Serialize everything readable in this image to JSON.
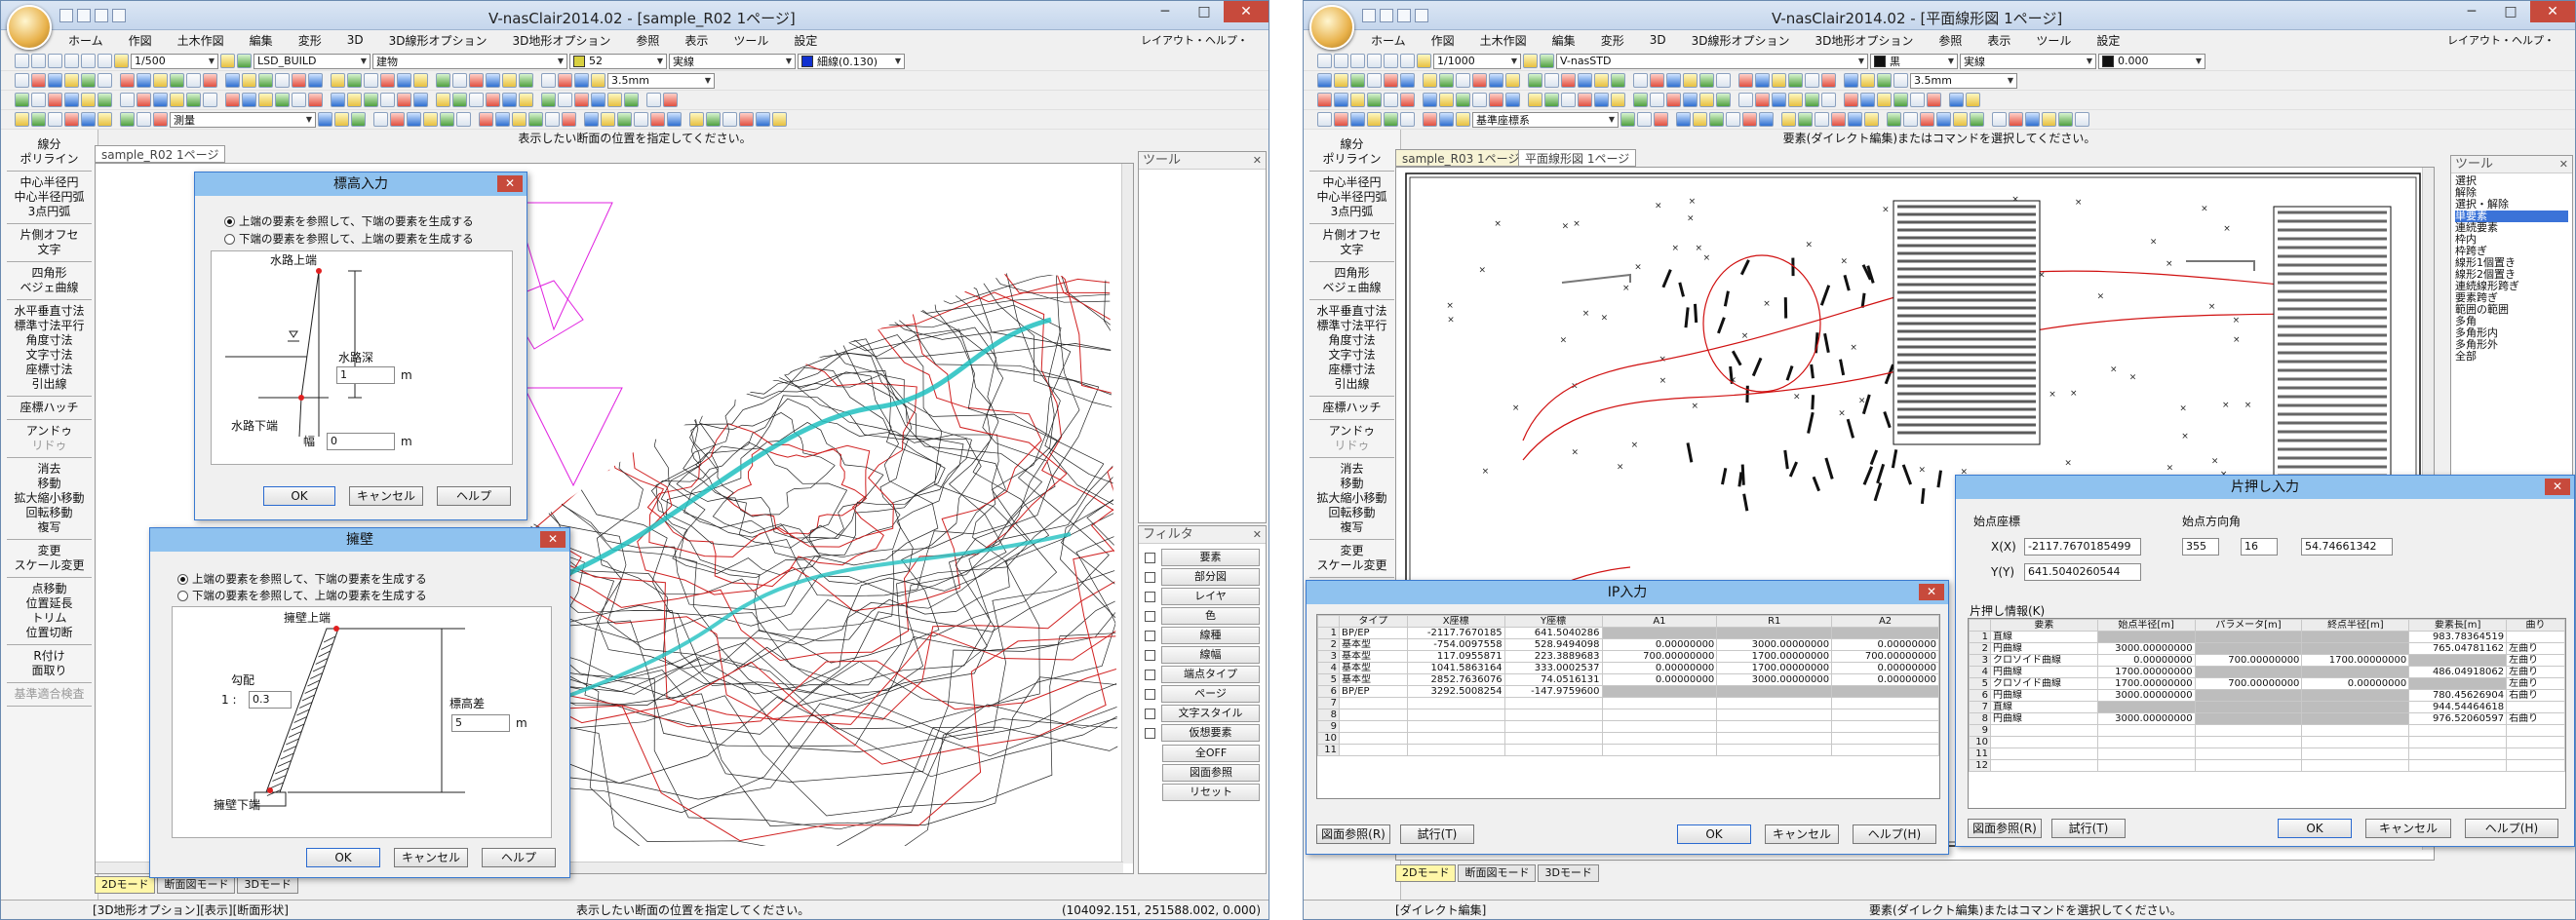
{
  "left": {
    "title": "V-nasClair2014.02 - [sample_R02 1ページ]",
    "menu": [
      "ホーム",
      "作図",
      "土木作図",
      "編集",
      "変形",
      "3D",
      "3D線形オプション",
      "3D地形オプション",
      "参照",
      "表示",
      "ツール",
      "設定"
    ],
    "menu_right": "レイアウト・ヘルプ・",
    "toolbar": {
      "scale": "1/500",
      "layer": "LSD_BUILD",
      "category": "建物",
      "color_num": "52",
      "line_type": "実線",
      "line_weight": "細線(0.130)",
      "width": "3.5mm",
      "mode": "測量"
    },
    "prompt": "表示したい断面の位置を指定してください。",
    "doc_tab": "sample_R02 1ページ",
    "commands": [
      [
        "線分",
        "ポリライン"
      ],
      [
        "中心半径円",
        "中心半径円弧",
        "3点円弧"
      ],
      [
        "片側オフセ",
        "文字"
      ],
      [
        "四角形",
        "ベジェ曲線"
      ],
      [
        "水平垂直寸法",
        "標準寸法平行",
        "角度寸法",
        "文字寸法",
        "座標寸法",
        "引出線"
      ],
      [
        "座標ハッチ"
      ],
      [
        "アンドゥ",
        "リドゥ"
      ],
      [
        "消去",
        "移動",
        "拡大縮小移動",
        "回転移動",
        "複写"
      ],
      [
        "変更",
        "スケール変更"
      ],
      [
        "点移動",
        "位置延長",
        "トリム",
        "位置切断"
      ],
      [
        "R付け",
        "面取り"
      ],
      [
        "基準適合検査"
      ]
    ],
    "tool_panel_title": "ツール",
    "filter_title": "フィルタ",
    "filters": [
      "要素",
      "部分図",
      "レイヤ",
      "色",
      "線種",
      "線幅",
      "端点タイプ",
      "ページ",
      "文字スタイル",
      "仮想要素"
    ],
    "filter_buttons": [
      "全OFF",
      "図面参照",
      "リセット"
    ],
    "mode_tabs": [
      "2Dモード",
      "断面図モード",
      "3Dモード"
    ],
    "status_left": "[3D地形オプション][表示][断面形状]",
    "status_center": "表示したい断面の位置を指定してください。",
    "status_right": "(104092.151, 251588.002, 0.000)",
    "dialog_elev": {
      "title": "標高入力",
      "opt1": "上端の要素を参照して、下端の要素を生成する",
      "opt2": "下端の要素を参照して、上端の要素を生成する",
      "top_label": "水路上端",
      "bottom_label": "水路下端",
      "depth_label": "水路深",
      "depth_value": "1",
      "depth_unit": "m",
      "width_label": "幅",
      "width_value": "0",
      "width_unit": "m",
      "ok": "OK",
      "cancel": "キャンセル",
      "help": "ヘルプ"
    },
    "dialog_wall": {
      "title": "擁壁",
      "opt1": "上端の要素を参照して、下端の要素を生成する",
      "opt2": "下端の要素を参照して、上端の要素を生成する",
      "top_label": "擁壁上端",
      "bottom_label": "擁壁下端",
      "slope_label": "勾配",
      "slope_prefix": "1 :",
      "slope_value": "0.3",
      "height_label": "標高差",
      "height_value": "5",
      "height_unit": "m",
      "ok": "OK",
      "cancel": "キャンセル",
      "help": "ヘルプ"
    }
  },
  "right": {
    "title": "V-nasClair2014.02 - [平面線形図 1ページ]",
    "menu": [
      "ホーム",
      "作図",
      "土木作図",
      "編集",
      "変形",
      "3D",
      "3D線形オプション",
      "3D地形オプション",
      "参照",
      "表示",
      "ツール",
      "設定"
    ],
    "menu_right": "レイアウト・ヘルプ・",
    "toolbar": {
      "scale": "1/1000",
      "layer": "V-nasSTD",
      "color_name": "黒",
      "line_type": "実線",
      "elev": "0.000",
      "width": "3.5mm",
      "mode": "基準座標系"
    },
    "prompt": "要素(ダイレクト編集)またはコマンドを選択してください。",
    "doc_tabs": [
      "sample_R03 1ページ",
      "平面線形図 1ページ"
    ],
    "commands": [
      [
        "線分",
        "ポリライン"
      ],
      [
        "中心半径円",
        "中心半径円弧",
        "3点円弧"
      ],
      [
        "片側オフセ",
        "文字"
      ],
      [
        "四角形",
        "ベジェ曲線"
      ],
      [
        "水平垂直寸法",
        "標準寸法平行",
        "角度寸法",
        "文字寸法",
        "座標寸法",
        "引出線"
      ],
      [
        "座標ハッチ"
      ],
      [
        "アンドゥ",
        "リドゥ"
      ],
      [
        "消去",
        "移動",
        "拡大縮小移動",
        "回転移動",
        "複写"
      ],
      [
        "変更",
        "スケール変更"
      ]
    ],
    "tool_panel_title": "ツール",
    "tool_list": [
      "選択",
      "解除",
      "選択・解除",
      "単要素",
      "連続要素",
      "枠内",
      "枠跨ぎ",
      "線形1個置き",
      "線形2個置き",
      "連続線形跨ぎ",
      "要素跨ぎ",
      "範囲の範囲",
      "多角",
      "多角形内",
      "多角形外",
      "全部"
    ],
    "mode_tabs": [
      "2Dモード",
      "断面図モード",
      "3Dモード"
    ],
    "status_left": "[ダイレクト編集]",
    "status_center": "要素(ダイレクト編集)またはコマンドを選択してください。",
    "dialog_ip": {
      "title": "IP入力",
      "headers": [
        "",
        "タイプ",
        "X座標",
        "Y座標",
        "A1",
        "R1",
        "A2"
      ],
      "rows": [
        [
          "1",
          "BP/EP",
          "-2117.7670185",
          "641.5040286",
          null,
          null,
          null
        ],
        [
          "2",
          "基本型",
          "-754.0097558",
          "528.9494098",
          "0.00000000",
          "3000.00000000",
          "0.00000000"
        ],
        [
          "3",
          "基本型",
          "117.0955871",
          "223.3889683",
          "700.00000000",
          "1700.00000000",
          "700.00000000"
        ],
        [
          "4",
          "基本型",
          "1041.5863164",
          "333.0002537",
          "0.00000000",
          "1700.00000000",
          "0.00000000"
        ],
        [
          "5",
          "基本型",
          "2852.7636076",
          "74.0516131",
          "0.00000000",
          "3000.00000000",
          "0.00000000"
        ],
        [
          "6",
          "BP/EP",
          "3292.5008254",
          "-147.9759600",
          null,
          null,
          null
        ],
        [
          "7",
          "",
          "",
          "",
          "",
          "",
          ""
        ],
        [
          "8",
          "",
          "",
          "",
          "",
          "",
          ""
        ],
        [
          "9",
          "",
          "",
          "",
          "",
          "",
          ""
        ],
        [
          "10",
          "",
          "",
          "",
          "",
          "",
          ""
        ],
        [
          "11",
          "",
          "",
          "",
          "",
          "",
          ""
        ]
      ],
      "ref_btn": "図面参照(R)",
      "try_btn": "試行(T)",
      "ok": "OK",
      "cancel": "キャンセル",
      "help": "ヘルプ(H)"
    },
    "dialog_offset": {
      "title": "片押し入力",
      "start_label": "始点座標",
      "x_label": "X(X)",
      "x_value": "-2117.7670185499",
      "y_label": "Y(Y)",
      "y_value": "641.5040260544",
      "dir_label": "始点方向角",
      "dir_deg": "355",
      "dir_min": "16",
      "dir_sec": "54.7466134​2",
      "info_label": "片押し情報(K)",
      "headers": [
        "",
        "要素",
        "始点半径[m]",
        "パラメータ[m]",
        "終点半径[m]",
        "要素長[m]",
        "曲り"
      ],
      "rows": [
        [
          "1",
          "直線",
          "",
          "",
          "",
          "983.7836451​9",
          ""
        ],
        [
          "2",
          "円曲線",
          "3000.00000000",
          "",
          "",
          "765.0478116​2",
          "左曲り"
        ],
        [
          "3",
          "クロソイド曲線",
          "0.00000000",
          "700.00000000",
          "1700.00000000",
          "",
          "左曲り"
        ],
        [
          "4",
          "円曲線",
          "1700.00000000",
          "",
          "",
          "486.0491806​2",
          "左曲り"
        ],
        [
          "5",
          "クロソイド曲線",
          "1700.00000000",
          "700.00000000",
          "0.00000000",
          "",
          "左曲り"
        ],
        [
          "6",
          "円曲線",
          "3000.00000000",
          "",
          "",
          "780.4562690​4",
          "右曲り"
        ],
        [
          "7",
          "直線",
          "",
          "",
          "",
          "944.5446461​8",
          ""
        ],
        [
          "8",
          "円曲線",
          "3000.00000000",
          "",
          "",
          "976.5206059​7",
          "右曲り"
        ],
        [
          "9",
          "",
          "",
          "",
          "",
          "",
          ""
        ],
        [
          "10",
          "",
          "",
          "",
          "",
          "",
          ""
        ],
        [
          "11",
          "",
          "",
          "",
          "",
          "",
          ""
        ],
        [
          "12",
          "",
          "",
          "",
          "",
          "",
          ""
        ]
      ],
      "ref_btn": "図面参照(R)",
      "try_btn": "試行(T)",
      "ok": "OK",
      "cancel": "キャンセル",
      "help": "ヘルプ(H)"
    }
  }
}
